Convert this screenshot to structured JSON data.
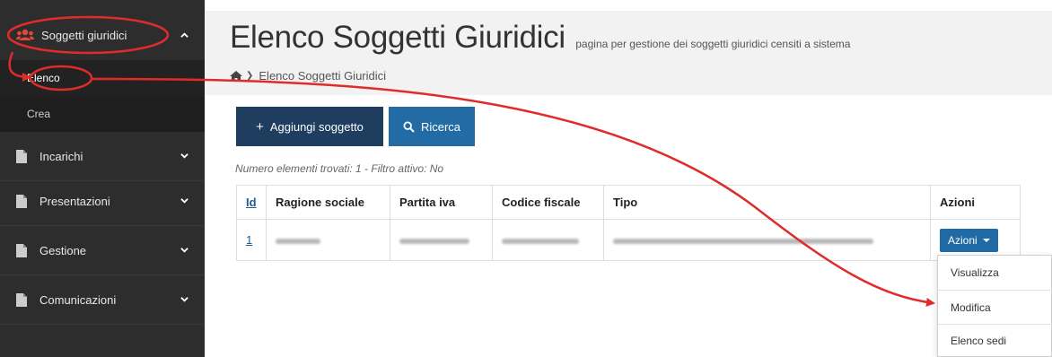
{
  "sidebar": {
    "groups": [
      {
        "label": "Soggetti giuridici",
        "icon": "users-icon",
        "expanded": true
      },
      {
        "label": "Incarichi",
        "icon": "document-icon"
      },
      {
        "label": "Presentazioni",
        "icon": "document-icon"
      },
      {
        "label": "Gestione",
        "icon": "document-icon"
      },
      {
        "label": "Comunicazioni",
        "icon": "document-icon"
      }
    ],
    "subitems": [
      {
        "label": "Elenco",
        "active": true
      },
      {
        "label": "Crea"
      }
    ],
    "accent": "#e8463a"
  },
  "header": {
    "title": "Elenco Soggetti Giuridici",
    "subtitle": "pagina per gestione dei soggetti giuridici censiti a sistema",
    "breadcrumb": [
      "Elenco Soggetti Giuridici"
    ]
  },
  "toolbar": {
    "add_label": "Aggiungi soggetto",
    "search_label": "Ricerca"
  },
  "status": "Numero elementi trovati: 1 - Filtro attivo: No",
  "table": {
    "headers": [
      "Id",
      "Ragione sociale",
      "Partita iva",
      "Codice fiscale",
      "Tipo",
      "Azioni"
    ],
    "rows": [
      {
        "id": "1",
        "actions_label": "Azioni"
      }
    ]
  },
  "dropdown": {
    "items": [
      "Visualizza",
      "Modifica",
      "Elenco sedi"
    ]
  },
  "colors": {
    "sidebar_bg": "#2d2d2d",
    "primary_dark": "#1e3d5f",
    "primary": "#236ba4",
    "annotation": "#e02b2b"
  }
}
